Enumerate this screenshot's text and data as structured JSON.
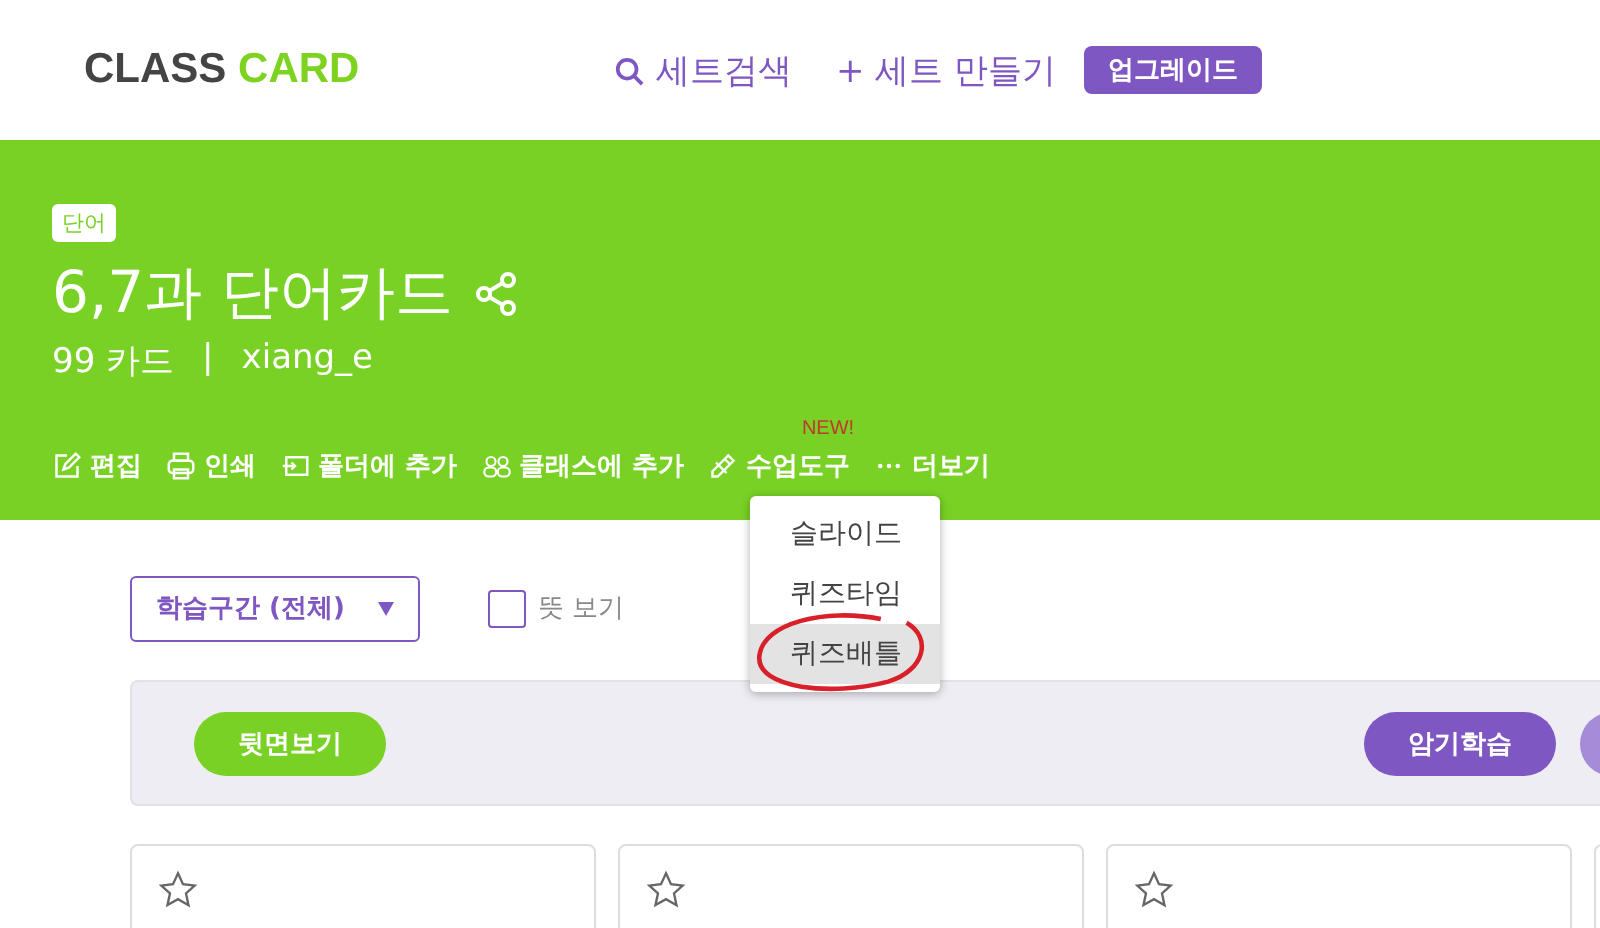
{
  "header": {
    "logo": {
      "part_1": "CLASS",
      "part_2": "CARD"
    },
    "nav": [
      {
        "kind": "search",
        "label": "세트검색"
      },
      {
        "kind": "create",
        "label": "+ 세트 만들기"
      },
      {
        "kind": "upgrade",
        "label": "업그레이드"
      }
    ]
  },
  "set": {
    "tag": "단어",
    "title": "6,7과 단어카드",
    "card_count": "99 카드",
    "separator": "|",
    "author": "xiang_e"
  },
  "toolbar": [
    {
      "kind": "edit",
      "label": "편집"
    },
    {
      "kind": "print",
      "label": "인쇄"
    },
    {
      "kind": "folder",
      "label": "폴더에 추가"
    },
    {
      "kind": "class",
      "label": "클래스에 추가"
    },
    {
      "kind": "tools",
      "label": "수업도구",
      "badge": "NEW!"
    },
    {
      "kind": "more",
      "label": "더보기"
    }
  ],
  "dropdown": [
    {
      "label": "슬라이드",
      "selected": false
    },
    {
      "label": "퀴즈타임",
      "selected": false
    },
    {
      "label": "퀴즈배틀",
      "selected": true
    }
  ],
  "controls": {
    "range": "학습구간 (전체)",
    "meaning": {
      "label": "뜻 보기",
      "checked": false
    }
  },
  "panel": {
    "flip": "뒷면보기",
    "study": "암기학습"
  },
  "cards": [
    {
      "starred": false
    },
    {
      "starred": false
    },
    {
      "starred": false
    }
  ]
}
